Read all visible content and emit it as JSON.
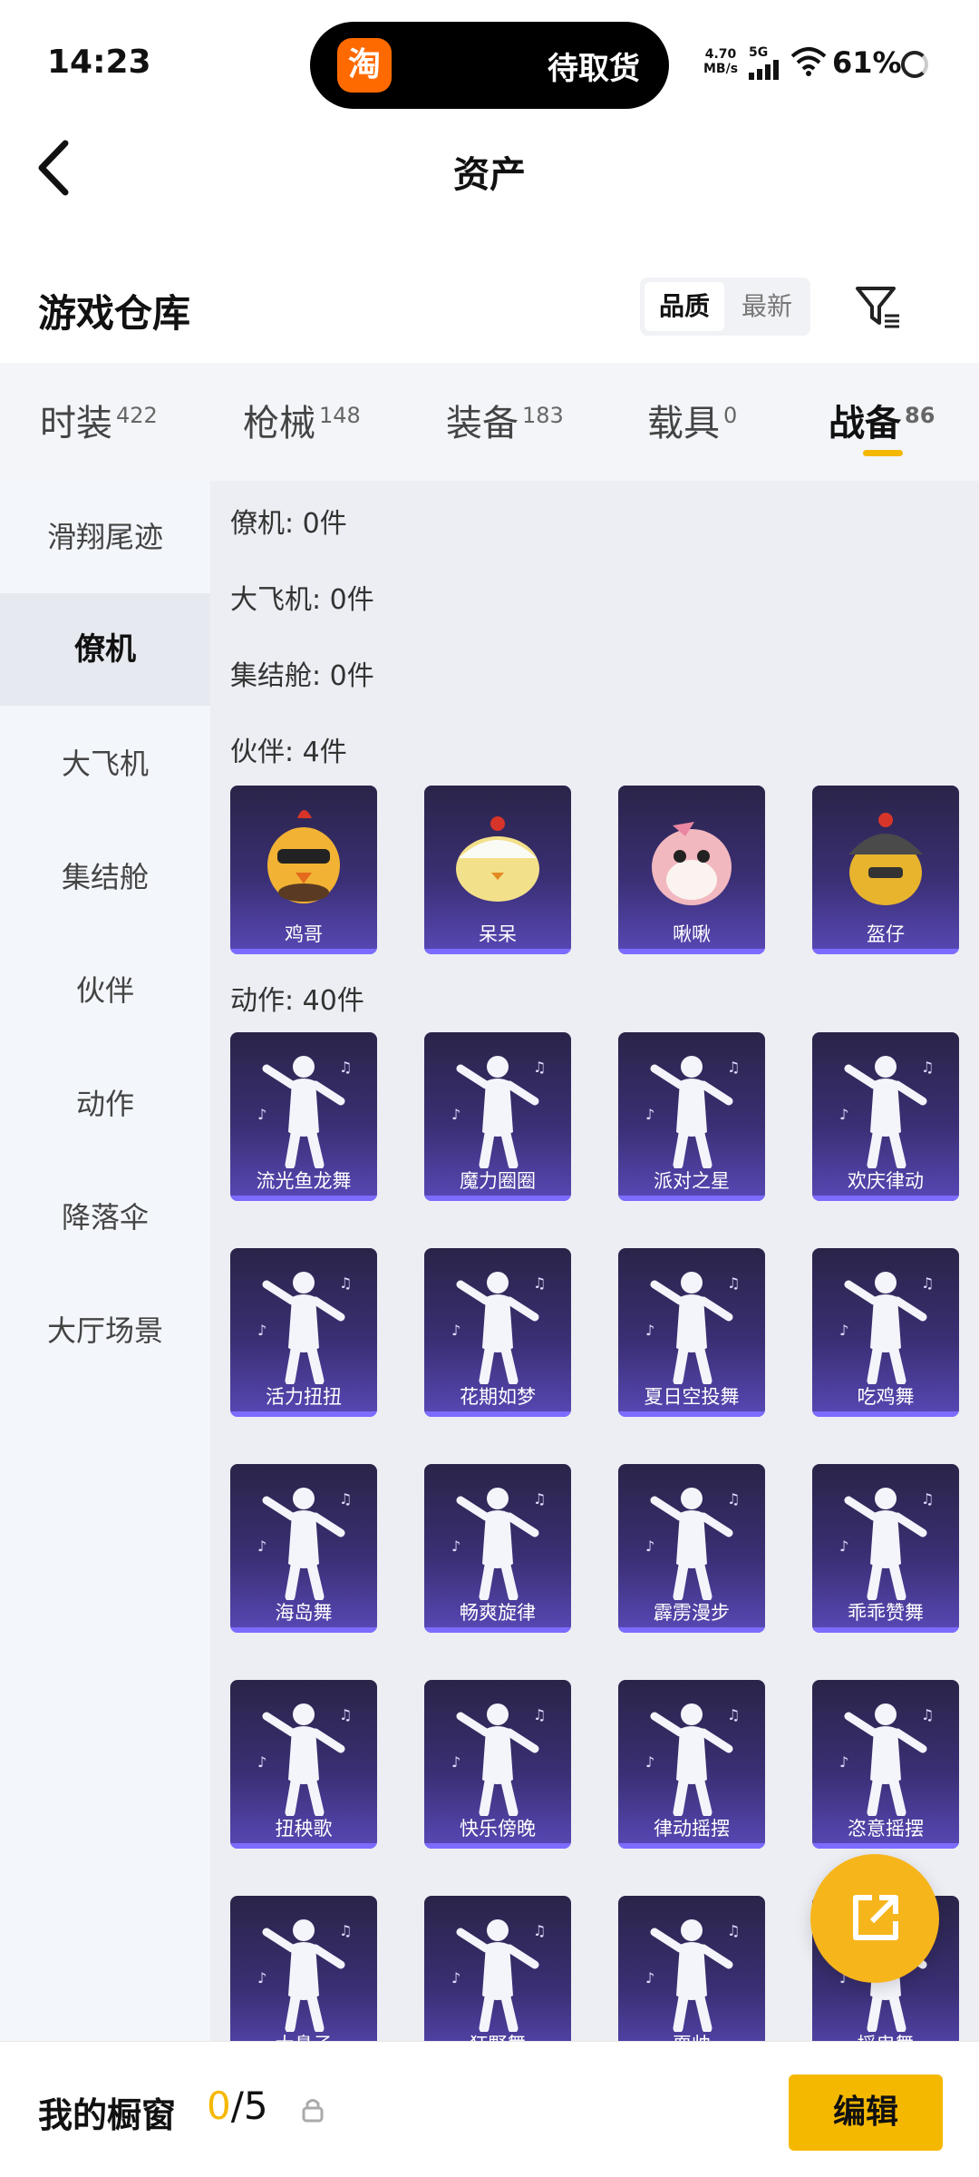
{
  "status": {
    "time": "14:23",
    "notification": "待取货",
    "app_badge": "淘",
    "speed": "4.70",
    "speed_unit": "MB/s",
    "network": "5G",
    "battery": "61%"
  },
  "header": {
    "title": "资产"
  },
  "section": {
    "title": "游戏仓库",
    "sort_options": [
      "品质",
      "最新"
    ]
  },
  "tabs": [
    {
      "label": "时装",
      "count": "422"
    },
    {
      "label": "枪械",
      "count": "148"
    },
    {
      "label": "装备",
      "count": "183"
    },
    {
      "label": "载具",
      "count": "0"
    },
    {
      "label": "战备",
      "count": "86"
    }
  ],
  "sidebar": {
    "items": [
      "滑翔尾迹",
      "僚机",
      "大飞机",
      "集结舱",
      "伙伴",
      "动作",
      "降落伞",
      "大厅场景"
    ]
  },
  "content": {
    "groups": [
      "僚机: 0件",
      "大飞机: 0件",
      "集结舱: 0件",
      "伙伴: 4件",
      "动作: 40件"
    ],
    "partners": [
      "鸡哥",
      "呆呆",
      "啾啾",
      "盔仔"
    ],
    "actions": [
      "流光鱼龙舞",
      "魔力圈圈",
      "派对之星",
      "欢庆律动",
      "活力扭扭",
      "花期如梦",
      "夏日空投舞",
      "吃鸡舞",
      "海岛舞",
      "畅爽旋律",
      "霹雳漫步",
      "乖乖赞舞",
      "扭秧歌",
      "快乐傍晚",
      "律动摇摆",
      "恣意摇摆",
      "大鼻子",
      "狂野舞",
      "耍帅",
      "摇曳舞"
    ]
  },
  "bottom": {
    "label": "我的橱窗",
    "count_current": "0",
    "count_total": "/5",
    "edit_label": "编辑"
  },
  "colors": {
    "accent": "#f5b800",
    "card_dark": "#2a2448",
    "card_light": "#5848b6"
  }
}
